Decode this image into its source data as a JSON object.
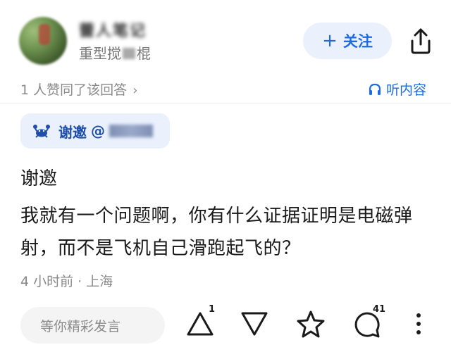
{
  "header": {
    "username": "蕾人笔记",
    "title_prefix": "重型搅",
    "title_suffix": "棍",
    "follow_label": "关注",
    "follow_icon": "plus-icon",
    "share_icon": "share-icon"
  },
  "answer_meta": {
    "agree_text": "1 人赞同了该回答",
    "agree_chevron": "›",
    "listen_label": "听内容",
    "listen_icon": "headphones-icon"
  },
  "invite": {
    "icon": "crab-icon",
    "label": "谢邀",
    "at": "@"
  },
  "content": {
    "line1": "谢邀",
    "paragraph": "我就有一个问题啊，你有什么证据证明是电磁弹射，而不是飞机自己滑跑起飞的？"
  },
  "post_meta": "4 小时前 · 上海",
  "bottom_bar": {
    "comment_placeholder": "等你精彩发言",
    "upvote_count": "1",
    "comment_count": "41"
  },
  "colors": {
    "accent": "#1f6be0",
    "chip_bg": "#eaf1fd",
    "muted": "#8a8a8a"
  }
}
